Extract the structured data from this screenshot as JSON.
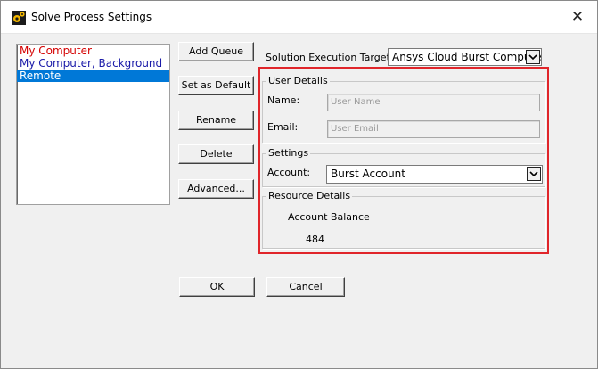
{
  "window": {
    "title": "Solve Process Settings",
    "close_glyph": "✕"
  },
  "queues": {
    "items": [
      {
        "label": "My Computer",
        "color": "#d40000",
        "selected": false
      },
      {
        "label": "My Computer, Background",
        "color": "#1a1aa8",
        "selected": false
      },
      {
        "label": "Remote",
        "color": "#ffffff",
        "selected": true
      }
    ],
    "selection_color": "#0078d7"
  },
  "actions": {
    "add_queue": "Add Queue",
    "set_default": "Set as Default",
    "rename": "Rename",
    "delete": "Delete",
    "advanced": "Advanced..."
  },
  "target": {
    "label": "Solution Execution Target:",
    "value": "Ansys Cloud Burst Compute"
  },
  "user_details": {
    "title": "User Details",
    "name_label": "Name:",
    "name_placeholder": "User Name",
    "email_label": "Email:",
    "email_placeholder": "User Email"
  },
  "settings": {
    "title": "Settings",
    "account_label": "Account:",
    "account_value": "Burst Account"
  },
  "resource": {
    "title": "Resource Details",
    "balance_label": "Account Balance",
    "balance_value": "484"
  },
  "footer": {
    "ok": "OK",
    "cancel": "Cancel"
  },
  "highlight_color": "#e0252a"
}
